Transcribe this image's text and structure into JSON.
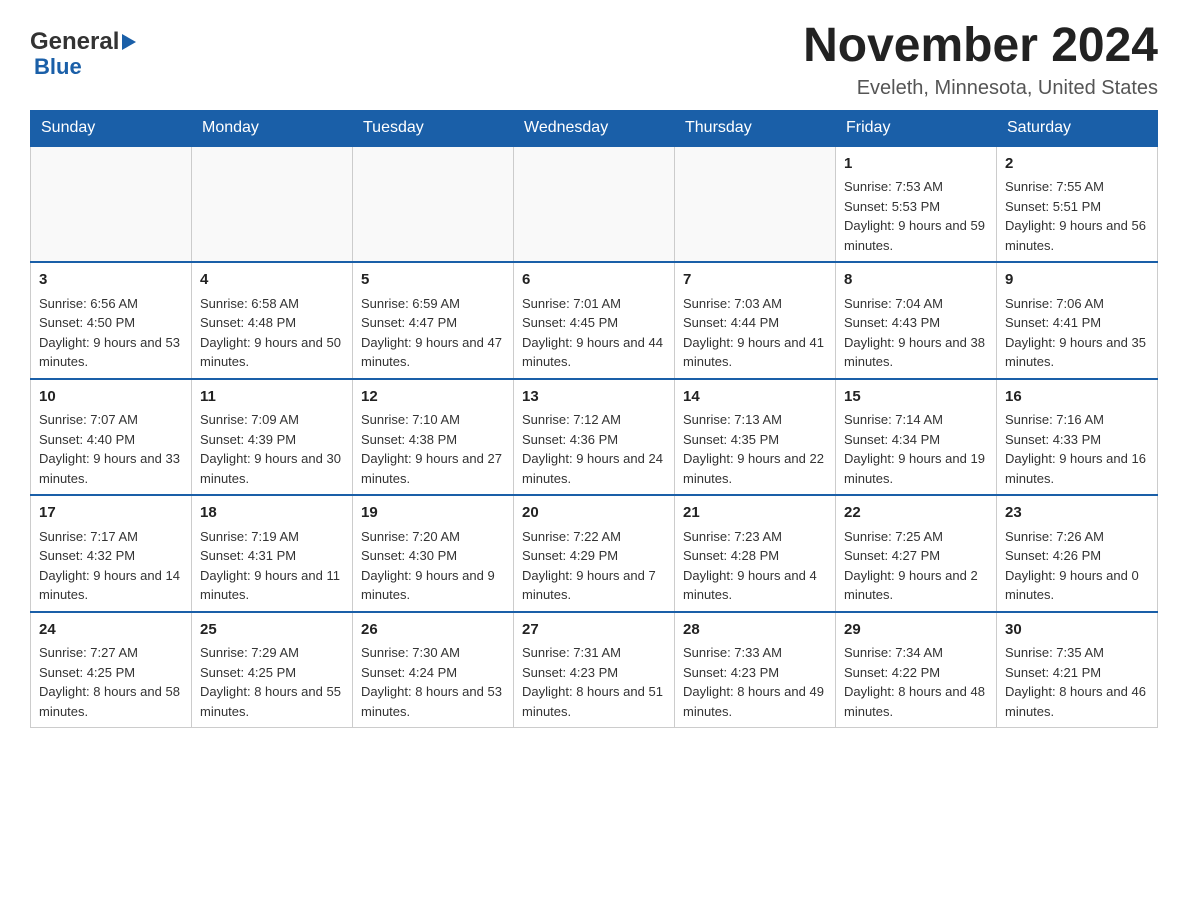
{
  "header": {
    "logo_general": "General",
    "logo_blue": "Blue",
    "title": "November 2024",
    "subtitle": "Eveleth, Minnesota, United States"
  },
  "days_of_week": [
    "Sunday",
    "Monday",
    "Tuesday",
    "Wednesday",
    "Thursday",
    "Friday",
    "Saturday"
  ],
  "weeks": [
    {
      "days": [
        {
          "num": "",
          "sunrise": "",
          "sunset": "",
          "daylight": "",
          "empty": true
        },
        {
          "num": "",
          "sunrise": "",
          "sunset": "",
          "daylight": "",
          "empty": true
        },
        {
          "num": "",
          "sunrise": "",
          "sunset": "",
          "daylight": "",
          "empty": true
        },
        {
          "num": "",
          "sunrise": "",
          "sunset": "",
          "daylight": "",
          "empty": true
        },
        {
          "num": "",
          "sunrise": "",
          "sunset": "",
          "daylight": "",
          "empty": true
        },
        {
          "num": "1",
          "sunrise": "Sunrise: 7:53 AM",
          "sunset": "Sunset: 5:53 PM",
          "daylight": "Daylight: 9 hours and 59 minutes.",
          "empty": false
        },
        {
          "num": "2",
          "sunrise": "Sunrise: 7:55 AM",
          "sunset": "Sunset: 5:51 PM",
          "daylight": "Daylight: 9 hours and 56 minutes.",
          "empty": false
        }
      ]
    },
    {
      "days": [
        {
          "num": "3",
          "sunrise": "Sunrise: 6:56 AM",
          "sunset": "Sunset: 4:50 PM",
          "daylight": "Daylight: 9 hours and 53 minutes.",
          "empty": false
        },
        {
          "num": "4",
          "sunrise": "Sunrise: 6:58 AM",
          "sunset": "Sunset: 4:48 PM",
          "daylight": "Daylight: 9 hours and 50 minutes.",
          "empty": false
        },
        {
          "num": "5",
          "sunrise": "Sunrise: 6:59 AM",
          "sunset": "Sunset: 4:47 PM",
          "daylight": "Daylight: 9 hours and 47 minutes.",
          "empty": false
        },
        {
          "num": "6",
          "sunrise": "Sunrise: 7:01 AM",
          "sunset": "Sunset: 4:45 PM",
          "daylight": "Daylight: 9 hours and 44 minutes.",
          "empty": false
        },
        {
          "num": "7",
          "sunrise": "Sunrise: 7:03 AM",
          "sunset": "Sunset: 4:44 PM",
          "daylight": "Daylight: 9 hours and 41 minutes.",
          "empty": false
        },
        {
          "num": "8",
          "sunrise": "Sunrise: 7:04 AM",
          "sunset": "Sunset: 4:43 PM",
          "daylight": "Daylight: 9 hours and 38 minutes.",
          "empty": false
        },
        {
          "num": "9",
          "sunrise": "Sunrise: 7:06 AM",
          "sunset": "Sunset: 4:41 PM",
          "daylight": "Daylight: 9 hours and 35 minutes.",
          "empty": false
        }
      ]
    },
    {
      "days": [
        {
          "num": "10",
          "sunrise": "Sunrise: 7:07 AM",
          "sunset": "Sunset: 4:40 PM",
          "daylight": "Daylight: 9 hours and 33 minutes.",
          "empty": false
        },
        {
          "num": "11",
          "sunrise": "Sunrise: 7:09 AM",
          "sunset": "Sunset: 4:39 PM",
          "daylight": "Daylight: 9 hours and 30 minutes.",
          "empty": false
        },
        {
          "num": "12",
          "sunrise": "Sunrise: 7:10 AM",
          "sunset": "Sunset: 4:38 PM",
          "daylight": "Daylight: 9 hours and 27 minutes.",
          "empty": false
        },
        {
          "num": "13",
          "sunrise": "Sunrise: 7:12 AM",
          "sunset": "Sunset: 4:36 PM",
          "daylight": "Daylight: 9 hours and 24 minutes.",
          "empty": false
        },
        {
          "num": "14",
          "sunrise": "Sunrise: 7:13 AM",
          "sunset": "Sunset: 4:35 PM",
          "daylight": "Daylight: 9 hours and 22 minutes.",
          "empty": false
        },
        {
          "num": "15",
          "sunrise": "Sunrise: 7:14 AM",
          "sunset": "Sunset: 4:34 PM",
          "daylight": "Daylight: 9 hours and 19 minutes.",
          "empty": false
        },
        {
          "num": "16",
          "sunrise": "Sunrise: 7:16 AM",
          "sunset": "Sunset: 4:33 PM",
          "daylight": "Daylight: 9 hours and 16 minutes.",
          "empty": false
        }
      ]
    },
    {
      "days": [
        {
          "num": "17",
          "sunrise": "Sunrise: 7:17 AM",
          "sunset": "Sunset: 4:32 PM",
          "daylight": "Daylight: 9 hours and 14 minutes.",
          "empty": false
        },
        {
          "num": "18",
          "sunrise": "Sunrise: 7:19 AM",
          "sunset": "Sunset: 4:31 PM",
          "daylight": "Daylight: 9 hours and 11 minutes.",
          "empty": false
        },
        {
          "num": "19",
          "sunrise": "Sunrise: 7:20 AM",
          "sunset": "Sunset: 4:30 PM",
          "daylight": "Daylight: 9 hours and 9 minutes.",
          "empty": false
        },
        {
          "num": "20",
          "sunrise": "Sunrise: 7:22 AM",
          "sunset": "Sunset: 4:29 PM",
          "daylight": "Daylight: 9 hours and 7 minutes.",
          "empty": false
        },
        {
          "num": "21",
          "sunrise": "Sunrise: 7:23 AM",
          "sunset": "Sunset: 4:28 PM",
          "daylight": "Daylight: 9 hours and 4 minutes.",
          "empty": false
        },
        {
          "num": "22",
          "sunrise": "Sunrise: 7:25 AM",
          "sunset": "Sunset: 4:27 PM",
          "daylight": "Daylight: 9 hours and 2 minutes.",
          "empty": false
        },
        {
          "num": "23",
          "sunrise": "Sunrise: 7:26 AM",
          "sunset": "Sunset: 4:26 PM",
          "daylight": "Daylight: 9 hours and 0 minutes.",
          "empty": false
        }
      ]
    },
    {
      "days": [
        {
          "num": "24",
          "sunrise": "Sunrise: 7:27 AM",
          "sunset": "Sunset: 4:25 PM",
          "daylight": "Daylight: 8 hours and 58 minutes.",
          "empty": false
        },
        {
          "num": "25",
          "sunrise": "Sunrise: 7:29 AM",
          "sunset": "Sunset: 4:25 PM",
          "daylight": "Daylight: 8 hours and 55 minutes.",
          "empty": false
        },
        {
          "num": "26",
          "sunrise": "Sunrise: 7:30 AM",
          "sunset": "Sunset: 4:24 PM",
          "daylight": "Daylight: 8 hours and 53 minutes.",
          "empty": false
        },
        {
          "num": "27",
          "sunrise": "Sunrise: 7:31 AM",
          "sunset": "Sunset: 4:23 PM",
          "daylight": "Daylight: 8 hours and 51 minutes.",
          "empty": false
        },
        {
          "num": "28",
          "sunrise": "Sunrise: 7:33 AM",
          "sunset": "Sunset: 4:23 PM",
          "daylight": "Daylight: 8 hours and 49 minutes.",
          "empty": false
        },
        {
          "num": "29",
          "sunrise": "Sunrise: 7:34 AM",
          "sunset": "Sunset: 4:22 PM",
          "daylight": "Daylight: 8 hours and 48 minutes.",
          "empty": false
        },
        {
          "num": "30",
          "sunrise": "Sunrise: 7:35 AM",
          "sunset": "Sunset: 4:21 PM",
          "daylight": "Daylight: 8 hours and 46 minutes.",
          "empty": false
        }
      ]
    }
  ]
}
